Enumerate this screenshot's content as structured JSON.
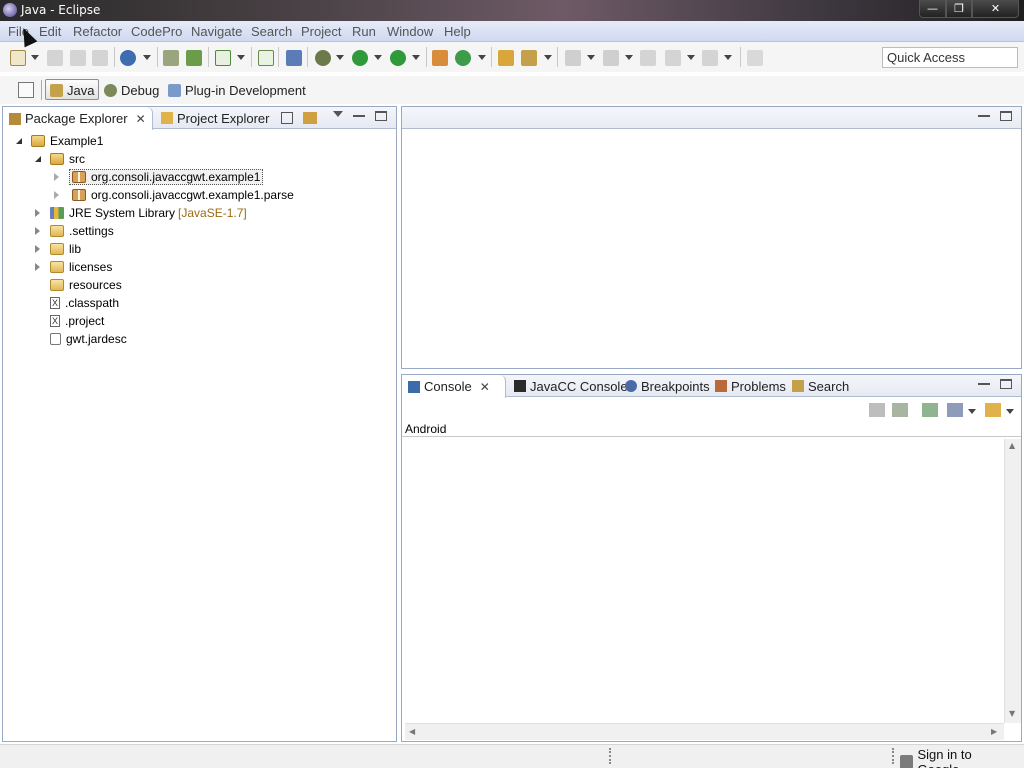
{
  "window": {
    "title": "Java - Eclipse"
  },
  "menu": [
    "File",
    "Edit",
    "Refactor",
    "CodePro",
    "Navigate",
    "Search",
    "Project",
    "Run",
    "Window",
    "Help"
  ],
  "toolbar": {
    "quick_access": "Quick Access"
  },
  "perspectives": {
    "items": [
      {
        "label": "Java",
        "active": true
      },
      {
        "label": "Debug",
        "active": false
      },
      {
        "label": "Plug-in Development",
        "active": false
      }
    ]
  },
  "left_view": {
    "tabs": [
      {
        "label": "Package Explorer",
        "active": true
      },
      {
        "label": "Project Explorer",
        "active": false
      }
    ],
    "tree": [
      {
        "label": "Example1",
        "icon": "project-icon",
        "level": 0,
        "expanded": true
      },
      {
        "label": "src",
        "icon": "source-folder-icon",
        "level": 1,
        "expanded": true
      },
      {
        "label": "org.consoli.javaccgwt.example1",
        "icon": "package-icon",
        "level": 2,
        "expanded": false,
        "selected": true
      },
      {
        "label": "org.consoli.javaccgwt.example1.parse",
        "icon": "package-icon",
        "level": 2,
        "expanded": false
      },
      {
        "label": "JRE System Library",
        "decoration": "[JavaSE-1.7]",
        "icon": "library-icon",
        "level": 1,
        "expanded": false
      },
      {
        "label": ".settings",
        "icon": "folder-icon",
        "level": 1,
        "expanded": false
      },
      {
        "label": "lib",
        "icon": "folder-icon",
        "level": 1,
        "expanded": false
      },
      {
        "label": "licenses",
        "icon": "folder-icon",
        "level": 1,
        "expanded": false
      },
      {
        "label": "resources",
        "icon": "folder-icon",
        "level": 1
      },
      {
        "label": ".classpath",
        "icon": "xml-file-icon",
        "level": 1
      },
      {
        "label": ".project",
        "icon": "xml-file-icon",
        "level": 1
      },
      {
        "label": "gwt.jardesc",
        "icon": "jar-desc-icon",
        "level": 1
      }
    ]
  },
  "console_view": {
    "tabs": [
      {
        "label": "Console",
        "active": true
      },
      {
        "label": "JavaCC Console",
        "active": false
      },
      {
        "label": "Breakpoints",
        "active": false
      },
      {
        "label": "Problems",
        "active": false
      },
      {
        "label": "Search",
        "active": false
      }
    ],
    "console_name": "Android",
    "content": ""
  },
  "status": {
    "signin": "Sign in to Google..."
  },
  "colors": {
    "accent": "#99a8c3",
    "menubar": "#dbe3f4",
    "selection_border": "#555555"
  }
}
